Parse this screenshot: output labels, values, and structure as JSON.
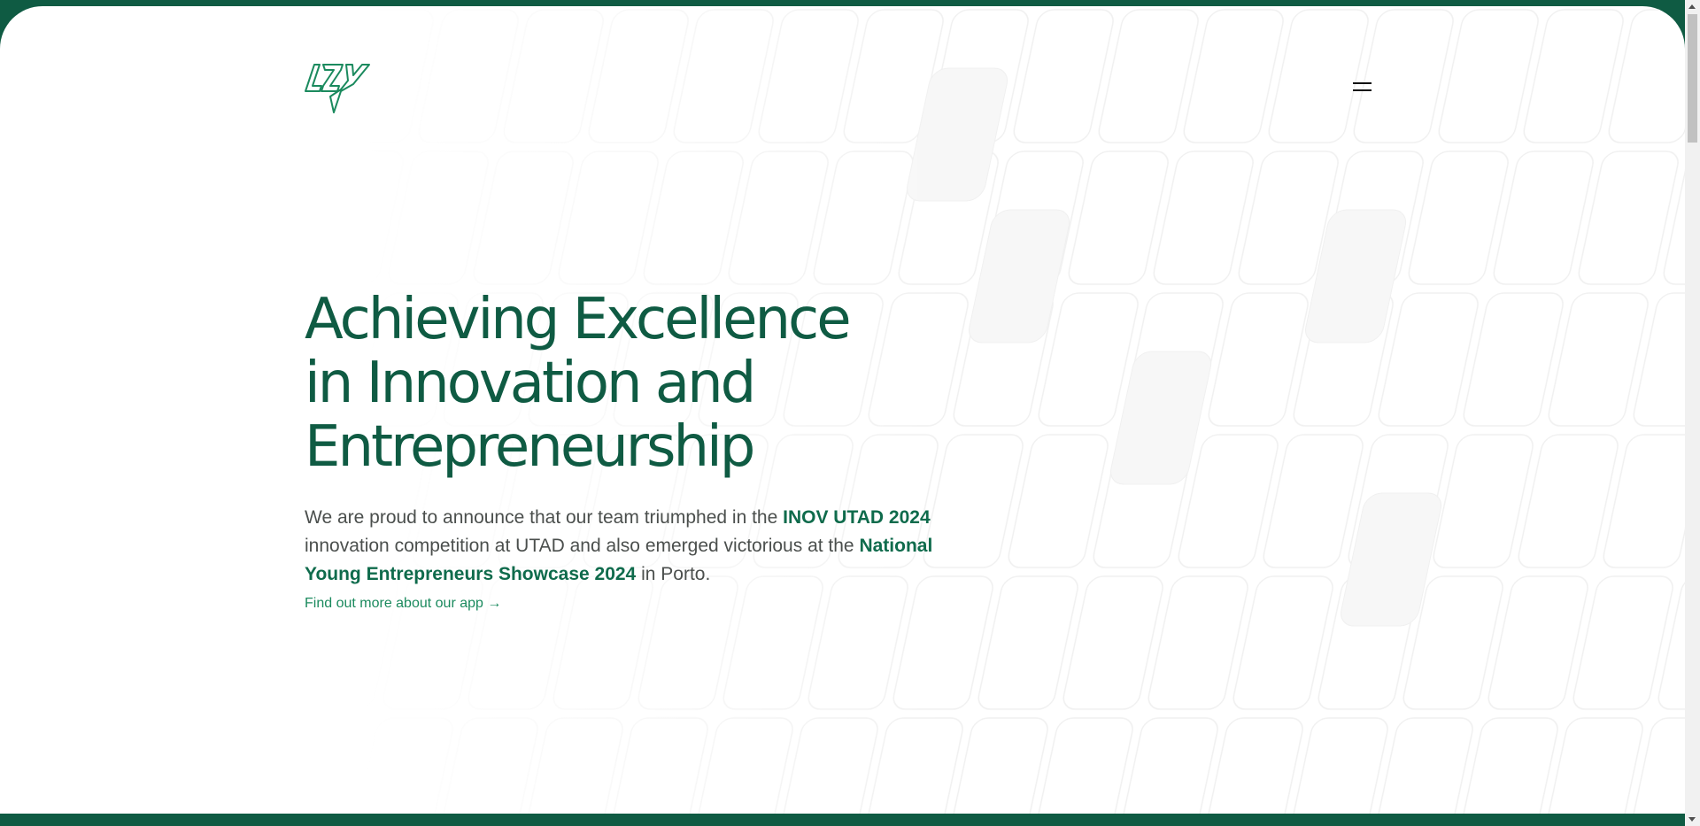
{
  "brand": {
    "logo_text": "LZY",
    "accent": "#0f5b43",
    "link_color": "#1b8a5e"
  },
  "nav": {
    "menu_icon": "hamburger-menu-icon"
  },
  "hero": {
    "headline_lines": [
      "Achieving Excellence",
      "in Innovation and",
      "Entrepreneurship"
    ],
    "lead": {
      "part1": "We are proud to announce that our team triumphed in the ",
      "highlight1": "INOV UTAD 2024",
      "part2": " innovation competition at UTAD and also emerged victorious at the ",
      "highlight2": "National Young Entrepreneurs Showcase 2024",
      "part3": " in Porto."
    },
    "link_text": "Find out more about our app →"
  }
}
